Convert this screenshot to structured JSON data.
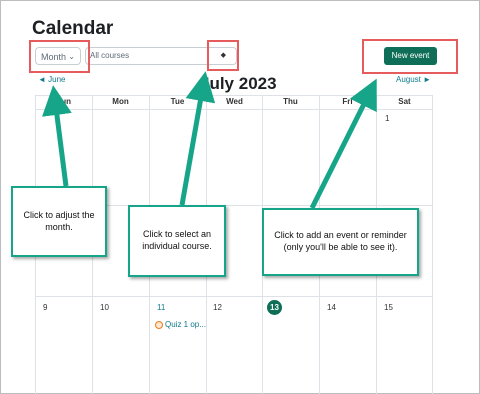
{
  "page": {
    "title": "Calendar"
  },
  "toolbar": {
    "month_select": {
      "label": "Month",
      "icon": "chevron-down-icon"
    },
    "course_select": {
      "label": "All courses",
      "icon": "up-down-arrows-icon"
    },
    "new_event_label": "New event"
  },
  "calendar": {
    "title": "July 2023",
    "prev_month": "June",
    "next_month": "August",
    "prev_glyph": "◄",
    "next_glyph": "►",
    "days": [
      "Sun",
      "Mon",
      "Tue",
      "Wed",
      "Thu",
      "Fri",
      "Sat"
    ],
    "numbers": {
      "sat_week1": "1",
      "sun_week3": "9",
      "mon_week3": "10",
      "tue_week3": "11",
      "wed_week3": "12",
      "today": "13",
      "fri_week3": "14",
      "sat_week3": "15"
    },
    "event": {
      "label": "Quiz 1 op...",
      "icon": "quiz-icon"
    }
  },
  "callouts": {
    "month": "Click to adjust the month.",
    "course": "Click to select an individual course.",
    "event": "Click to add an event or reminder (only you'll be able to see it)."
  },
  "colors": {
    "accent": "#0f6e57",
    "link": "#0f7a8c",
    "callout_border": "#17a589",
    "highlight_box": "#e65b5b"
  }
}
